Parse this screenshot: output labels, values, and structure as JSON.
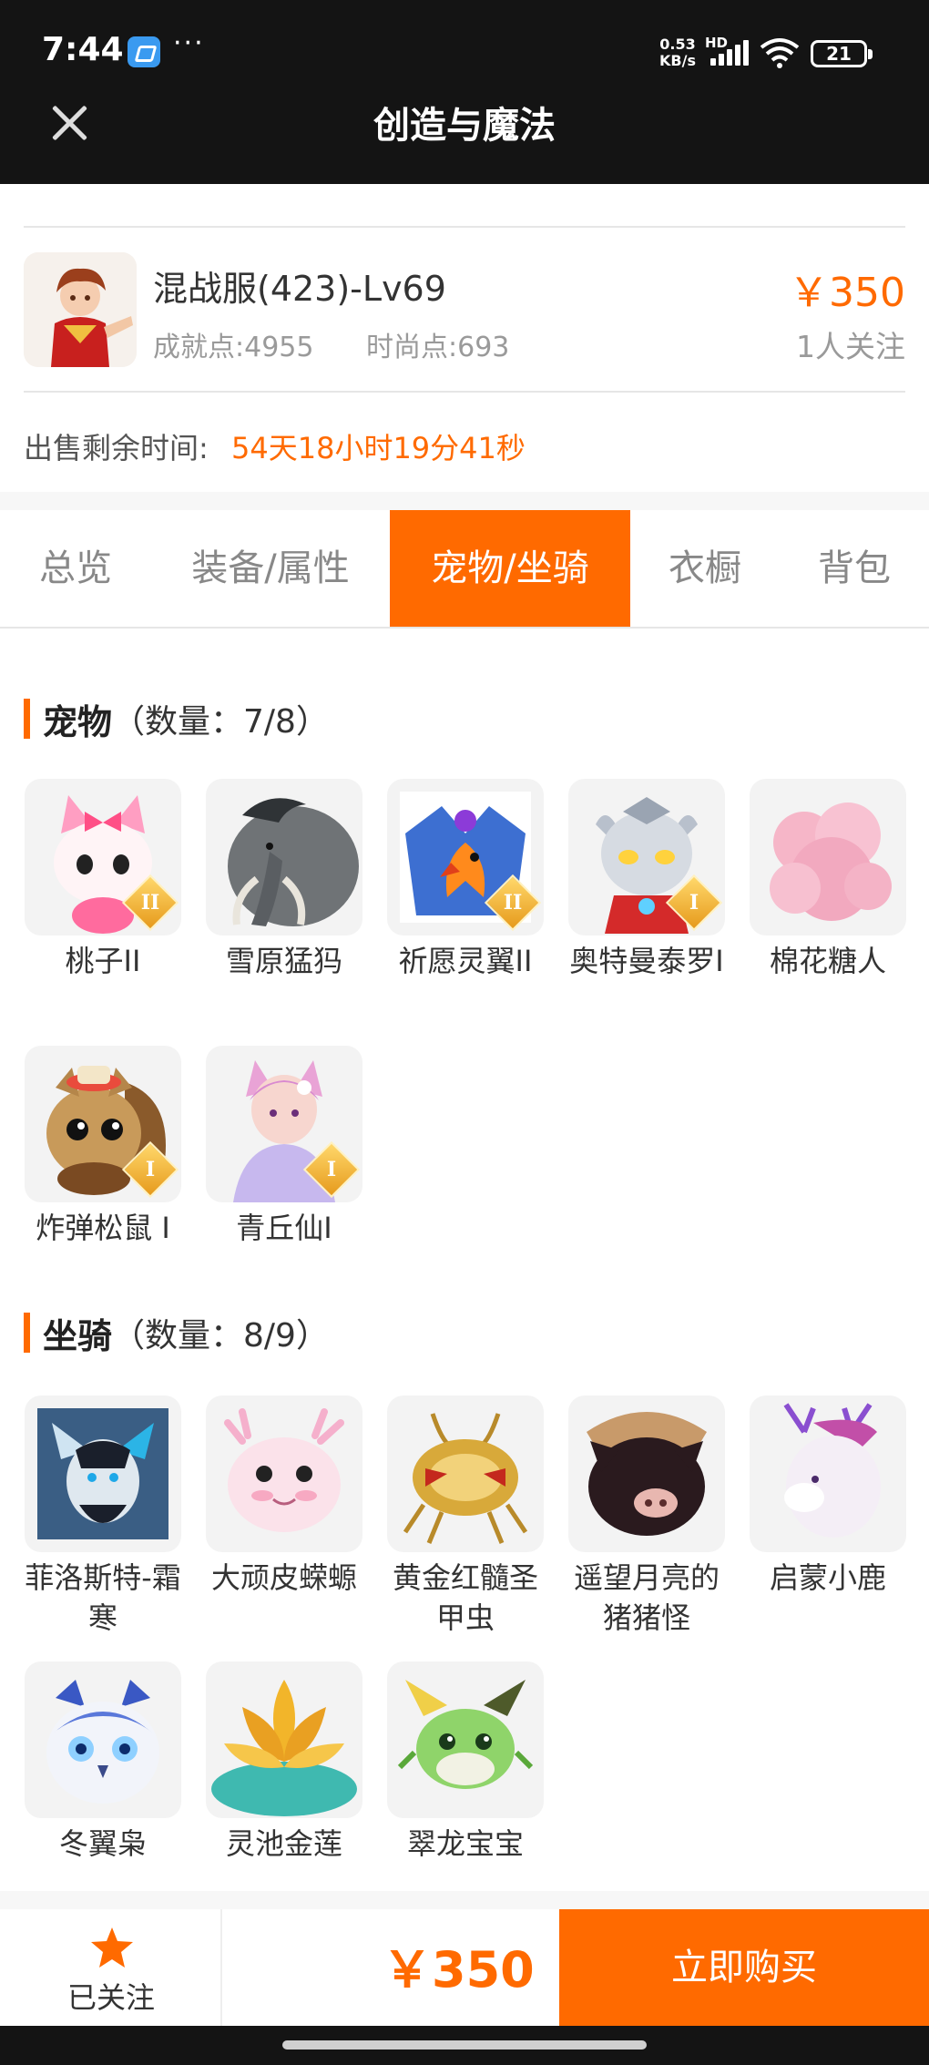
{
  "status_bar": {
    "time": "7:44",
    "net_speed": "0.53",
    "net_unit": "KB/s",
    "hd": "HD",
    "battery": "21"
  },
  "header": {
    "title": "创造与魔法"
  },
  "role": {
    "name": "混战服(423)-Lv69",
    "achievement": "成就点:4955",
    "fashion": "时尚点:693",
    "price": "￥350",
    "followers": "1人关注"
  },
  "sale": {
    "label": "出售剩余时间:",
    "remaining": "54天18小时19分41秒"
  },
  "tabs": [
    {
      "label": "总览"
    },
    {
      "label": "装备/属性"
    },
    {
      "label": "宠物/坐骑",
      "active": true
    },
    {
      "label": "衣橱"
    },
    {
      "label": "背包"
    }
  ],
  "pets": {
    "title": "宠物",
    "count": "（数量：7/8）",
    "items": [
      {
        "name": "桃子II",
        "icon": "pink-fox-pet-icon",
        "badge": "II"
      },
      {
        "name": "雪原猛犸",
        "icon": "mammoth-pet-icon",
        "badge": ""
      },
      {
        "name": "祈愿灵翼II",
        "icon": "phoenix-pet-icon",
        "badge": "II"
      },
      {
        "name": "奥特曼泰罗I",
        "icon": "ultraman-pet-icon",
        "badge": "I"
      },
      {
        "name": "棉花糖人",
        "icon": "cotton-candy-pet-icon",
        "badge": ""
      },
      {
        "name": "炸弹松鼠 I",
        "icon": "squirrel-pet-icon",
        "badge": "I"
      },
      {
        "name": "青丘仙I",
        "icon": "fox-fairy-pet-icon",
        "badge": "I"
      }
    ]
  },
  "mounts": {
    "title": "坐骑",
    "count": "（数量：8/9）",
    "items": [
      {
        "name": "菲洛斯特-霜寒",
        "icon": "frost-dragon-mount-icon"
      },
      {
        "name": "大顽皮蝾螈",
        "icon": "axolotl-mount-icon"
      },
      {
        "name": "黄金红髓圣甲虫",
        "icon": "scarab-mount-icon"
      },
      {
        "name": "遥望月亮的猪猪怪",
        "icon": "pig-mount-icon"
      },
      {
        "name": "启蒙小鹿",
        "icon": "deer-mount-icon"
      },
      {
        "name": "冬翼枭",
        "icon": "owl-mount-icon"
      },
      {
        "name": "灵池金莲",
        "icon": "lotus-mount-icon"
      },
      {
        "name": "翠龙宝宝",
        "icon": "green-dragon-mount-icon"
      }
    ]
  },
  "bottom": {
    "follow_label": "已关注",
    "price": "￥350",
    "buy_label": "立即购买"
  },
  "colors": {
    "accent": "#ff6a00",
    "header_bg": "#141414"
  }
}
